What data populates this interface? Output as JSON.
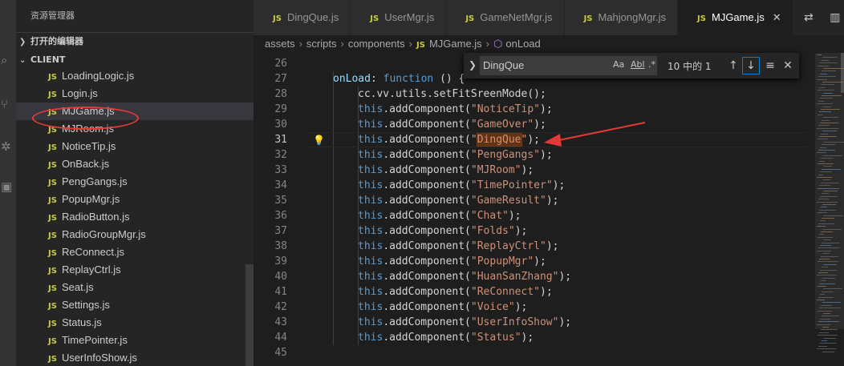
{
  "explorer": {
    "title": "资源管理器",
    "open_editors_label": "打开的编辑器",
    "folder_label": "CLIENT",
    "files": [
      {
        "name": "LoadingLogic.js",
        "selected": false
      },
      {
        "name": "Login.js",
        "selected": false
      },
      {
        "name": "MJGame.js",
        "selected": true
      },
      {
        "name": "MJRoom.js",
        "selected": false
      },
      {
        "name": "NoticeTip.js",
        "selected": false
      },
      {
        "name": "OnBack.js",
        "selected": false
      },
      {
        "name": "PengGangs.js",
        "selected": false
      },
      {
        "name": "PopupMgr.js",
        "selected": false
      },
      {
        "name": "RadioButton.js",
        "selected": false
      },
      {
        "name": "RadioGroupMgr.js",
        "selected": false
      },
      {
        "name": "ReConnect.js",
        "selected": false
      },
      {
        "name": "ReplayCtrl.js",
        "selected": false
      },
      {
        "name": "Seat.js",
        "selected": false
      },
      {
        "name": "Settings.js",
        "selected": false
      },
      {
        "name": "Status.js",
        "selected": false
      },
      {
        "name": "TimePointer.js",
        "selected": false
      },
      {
        "name": "UserInfoShow.js",
        "selected": false
      }
    ],
    "file_icon_text": "JS"
  },
  "tabs": [
    {
      "label": "DingQue.js",
      "active": false
    },
    {
      "label": "UserMgr.js",
      "active": false
    },
    {
      "label": "GameNetMgr.js",
      "active": false
    },
    {
      "label": "MahjongMgr.js",
      "active": false
    },
    {
      "label": "MJGame.js",
      "active": true
    }
  ],
  "breadcrumb": {
    "parts": [
      "assets",
      "scripts",
      "components"
    ],
    "file": "MJGame.js",
    "symbol": "onLoad"
  },
  "find": {
    "value": "DingQue",
    "opt_case": "Aa",
    "opt_word": "Abl",
    "opt_regex": ".*",
    "count": "10 中的 1"
  },
  "code": {
    "lines": [
      {
        "n": "26",
        "kind": "blank"
      },
      {
        "n": "27",
        "kind": "onload"
      },
      {
        "n": "28",
        "kind": "setfit"
      },
      {
        "n": "29",
        "kind": "add",
        "arg": "NoticeTip"
      },
      {
        "n": "30",
        "kind": "add",
        "arg": "GameOver"
      },
      {
        "n": "31",
        "kind": "add",
        "arg": "DingQue",
        "current": true,
        "highlight": true
      },
      {
        "n": "32",
        "kind": "add",
        "arg": "PengGangs"
      },
      {
        "n": "33",
        "kind": "add",
        "arg": "MJRoom"
      },
      {
        "n": "34",
        "kind": "add",
        "arg": "TimePointer"
      },
      {
        "n": "35",
        "kind": "add",
        "arg": "GameResult"
      },
      {
        "n": "36",
        "kind": "add",
        "arg": "Chat"
      },
      {
        "n": "37",
        "kind": "add",
        "arg": "Folds"
      },
      {
        "n": "38",
        "kind": "add",
        "arg": "ReplayCtrl"
      },
      {
        "n": "39",
        "kind": "add",
        "arg": "PopupMgr"
      },
      {
        "n": "40",
        "kind": "add",
        "arg": "HuanSanZhang"
      },
      {
        "n": "41",
        "kind": "add",
        "arg": "ReConnect"
      },
      {
        "n": "42",
        "kind": "add",
        "arg": "Voice"
      },
      {
        "n": "43",
        "kind": "add",
        "arg": "UserInfoShow"
      },
      {
        "n": "44",
        "kind": "add",
        "arg": "Status"
      },
      {
        "n": "45",
        "kind": "blank"
      }
    ],
    "tokens": {
      "onload_name": "onLoad",
      "function_kw": "function",
      "onload_tail": " () {",
      "colon": ": ",
      "setfit": "cc.vv.utils.setFitSreenMode();",
      "this_kw": "this",
      "add_call": ".addComponent(",
      "quote": "\"",
      "close": ");"
    }
  },
  "colors": {
    "accent": "#007fd4",
    "annotation_red": "#e53935",
    "js_icon": "#cbcb41"
  }
}
